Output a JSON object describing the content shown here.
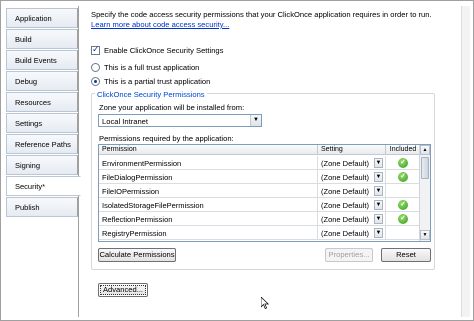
{
  "sidebar": {
    "items": [
      {
        "label": "Application"
      },
      {
        "label": "Build"
      },
      {
        "label": "Build Events"
      },
      {
        "label": "Debug"
      },
      {
        "label": "Resources"
      },
      {
        "label": "Settings"
      },
      {
        "label": "Reference Paths"
      },
      {
        "label": "Signing"
      },
      {
        "label": "Security*"
      },
      {
        "label": "Publish"
      }
    ],
    "active": "Security*"
  },
  "security": {
    "description": "Specify the code access security permissions that your ClickOnce application requires in order to run.",
    "learn_more": "Learn more about code access security...",
    "enable_label": "Enable ClickOnce Security Settings",
    "full_trust_label": "This is a full trust application",
    "partial_trust_label": "This is a partial trust application",
    "group_title": "ClickOnce Security Permissions",
    "zone_label": "Zone your application will be installed from:",
    "zone_value": "Local Intranet",
    "permissions_label": "Permissions required by the application:",
    "columns": [
      "Permission",
      "Setting",
      "Included"
    ],
    "rows": [
      {
        "permission": "EnvironmentPermission",
        "setting": "(Zone Default)",
        "included": true
      },
      {
        "permission": "FileDialogPermission",
        "setting": "(Zone Default)",
        "included": true
      },
      {
        "permission": "FileIOPermission",
        "setting": "(Zone Default)",
        "included": false
      },
      {
        "permission": "IsolatedStorageFilePermission",
        "setting": "(Zone Default)",
        "included": true
      },
      {
        "permission": "ReflectionPermission",
        "setting": "(Zone Default)",
        "included": true
      },
      {
        "permission": "RegistryPermission",
        "setting": "(Zone Default)",
        "included": false
      }
    ],
    "calculate_label": "Calculate Permissions",
    "properties_label": "Properties...",
    "reset_label": "Reset",
    "advanced_label": "Advanced..."
  },
  "colors": {
    "link": "#0033cc",
    "group_title": "#0046d5",
    "included_icon": "#2f9a1d"
  }
}
